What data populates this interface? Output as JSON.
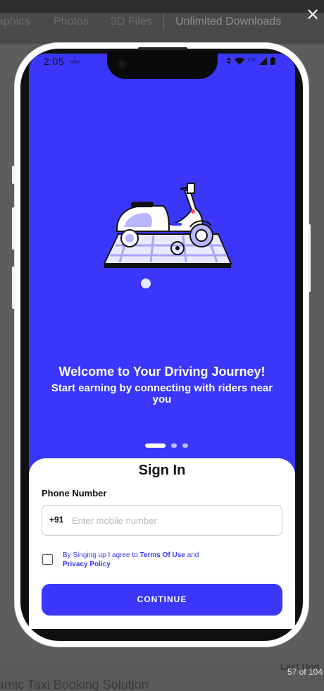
{
  "background_page": {
    "nav_items": [
      "aphics",
      "Photos",
      "3D Files",
      "Unlimited Downloads"
    ],
    "title_partial": "amic Taxi Booking Solution",
    "last_updated_partial": "Last Upd"
  },
  "lightbox": {
    "counter": "57 of 104",
    "close_icon": "close-icon",
    "close_glyph": "✕"
  },
  "phone": {
    "status_bar": {
      "time": "2:05",
      "speed_value": "7",
      "speed_unit": "KB/s",
      "network": "LTE"
    },
    "onboarding": {
      "title": "Welcome to Your Driving Journey!",
      "subtitle": "Start earning by connecting with riders near you",
      "pages_total": 3,
      "active_page": 1
    },
    "sign_in": {
      "title": "Sign In",
      "phone_label": "Phone Number",
      "country_code": "+91",
      "phone_placeholder": "Enter mobile number",
      "phone_value": "",
      "terms_prefix": "By Singing up I agree to ",
      "terms_link": "Terms Of Use",
      "terms_middle": " and ",
      "privacy_link": "Privacy Policy",
      "terms_checked": false,
      "continue_label": "CONTINUE"
    }
  },
  "colors": {
    "brand_primary": "#3a37fb",
    "sheet_background": "#ffffff",
    "pager_inactive": "#bfbeff"
  }
}
